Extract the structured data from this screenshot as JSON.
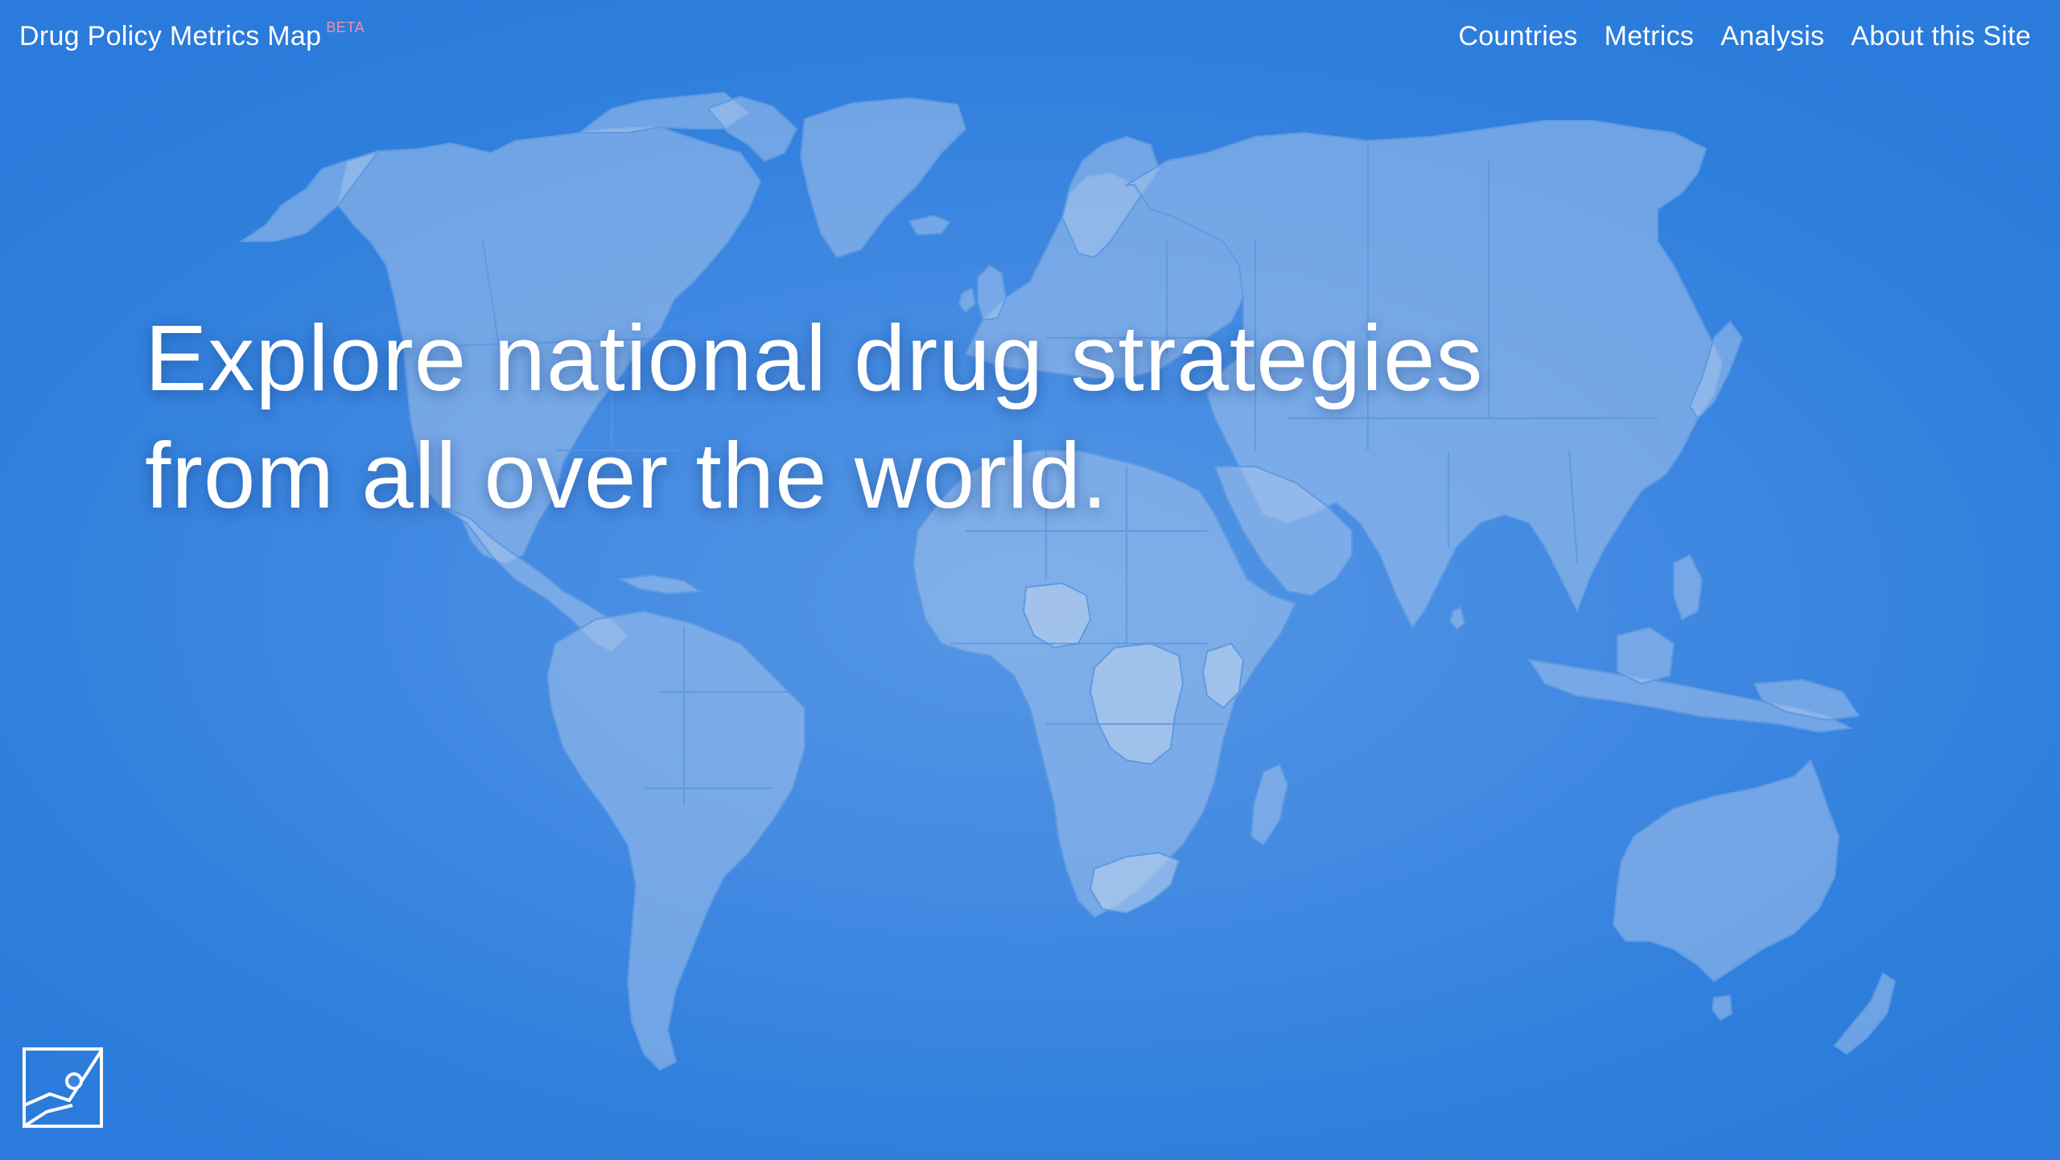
{
  "site": {
    "title": "Drug Policy Metrics Map",
    "badge": "BETA",
    "badge_color": "#f28fb0"
  },
  "nav": {
    "items": [
      {
        "label": "Countries"
      },
      {
        "label": "Metrics"
      },
      {
        "label": "Analysis"
      },
      {
        "label": "About this Site"
      }
    ]
  },
  "hero": {
    "line1": "Explore national drug strategies",
    "line2": "from all over the world."
  },
  "logo": {
    "icon": "map-logo-icon"
  },
  "background": {
    "icon": "world-map",
    "color": "#3a86df"
  }
}
